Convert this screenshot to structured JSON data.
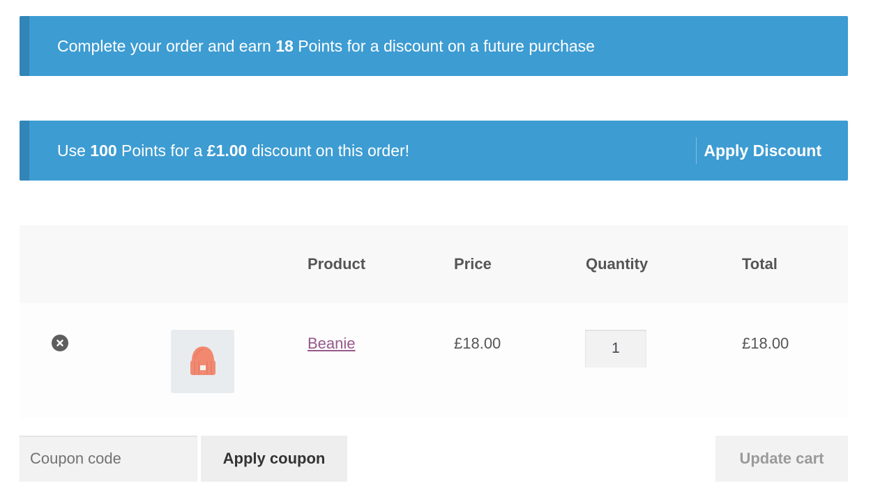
{
  "notices": {
    "earn": {
      "prefix": "Complete your order and earn ",
      "points": "18",
      "suffix": " Points for a discount on a future purchase"
    },
    "redeem": {
      "prefix": "Use ",
      "points": "100",
      "middle": " Points for a ",
      "amount": "£1.00",
      "suffix": " discount on this order!",
      "action_label": "Apply Discount"
    }
  },
  "cart": {
    "headers": {
      "product": "Product",
      "price": "Price",
      "quantity": "Quantity",
      "total": "Total"
    },
    "items": [
      {
        "name": "Beanie",
        "price": "£18.00",
        "quantity": "1",
        "total": "£18.00"
      }
    ]
  },
  "actions": {
    "coupon_placeholder": "Coupon code",
    "apply_coupon_label": "Apply coupon",
    "update_cart_label": "Update cart"
  },
  "colors": {
    "notice_bg": "#3d9cd2",
    "notice_border": "#3285b7",
    "product_link": "#96588a",
    "beanie": "#f2886f"
  }
}
